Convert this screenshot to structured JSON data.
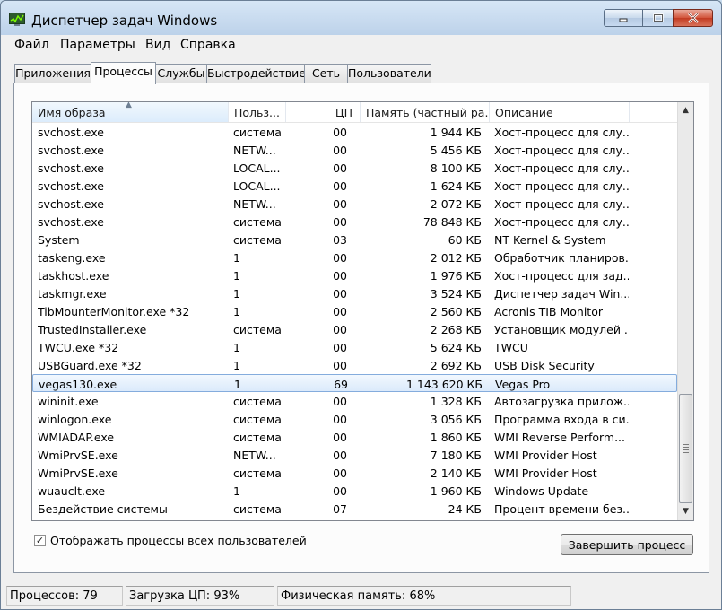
{
  "window": {
    "title": "Диспетчер задач Windows",
    "caption_buttons": {
      "minimize": "minimize-icon",
      "maximize": "maximize-icon",
      "close": "close-icon"
    }
  },
  "menu": [
    "Файл",
    "Параметры",
    "Вид",
    "Справка"
  ],
  "tabs": [
    {
      "label": "Приложения",
      "active": false
    },
    {
      "label": "Процессы",
      "active": true
    },
    {
      "label": "Службы",
      "active": false
    },
    {
      "label": "Быстродействие",
      "active": false
    },
    {
      "label": "Сеть",
      "active": false
    },
    {
      "label": "Пользователи",
      "active": false
    }
  ],
  "table": {
    "columns": [
      "Имя образа",
      "Польз...",
      "ЦП",
      "Память (частный ра...",
      "Описание"
    ],
    "sorted_column": "Имя образа",
    "rows": [
      {
        "name": "svchost.exe",
        "user": "система",
        "cpu": "00",
        "mem": "1 944 КБ",
        "desc": "Хост-процесс для слу..."
      },
      {
        "name": "svchost.exe",
        "user": "NETW...",
        "cpu": "00",
        "mem": "5 456 КБ",
        "desc": "Хост-процесс для слу..."
      },
      {
        "name": "svchost.exe",
        "user": "LOCAL...",
        "cpu": "00",
        "mem": "8 100 КБ",
        "desc": "Хост-процесс для слу..."
      },
      {
        "name": "svchost.exe",
        "user": "LOCAL...",
        "cpu": "00",
        "mem": "1 624 КБ",
        "desc": "Хост-процесс для слу..."
      },
      {
        "name": "svchost.exe",
        "user": "NETW...",
        "cpu": "00",
        "mem": "2 072 КБ",
        "desc": "Хост-процесс для слу..."
      },
      {
        "name": "svchost.exe",
        "user": "система",
        "cpu": "00",
        "mem": "78 848 КБ",
        "desc": "Хост-процесс для слу..."
      },
      {
        "name": "System",
        "user": "система",
        "cpu": "03",
        "mem": "60 КБ",
        "desc": "NT Kernel & System"
      },
      {
        "name": "taskeng.exe",
        "user": "1",
        "cpu": "00",
        "mem": "2 012 КБ",
        "desc": "Обработчик планиров..."
      },
      {
        "name": "taskhost.exe",
        "user": "1",
        "cpu": "00",
        "mem": "1 976 КБ",
        "desc": "Хост-процесс для зад..."
      },
      {
        "name": "taskmgr.exe",
        "user": "1",
        "cpu": "00",
        "mem": "3 524 КБ",
        "desc": "Диспетчер задач Win..."
      },
      {
        "name": "TibMounterMonitor.exe *32",
        "user": "1",
        "cpu": "00",
        "mem": "2 560 КБ",
        "desc": "Acronis TIB Monitor"
      },
      {
        "name": "TrustedInstaller.exe",
        "user": "система",
        "cpu": "00",
        "mem": "2 268 КБ",
        "desc": "Установщик модулей ..."
      },
      {
        "name": "TWCU.exe *32",
        "user": "1",
        "cpu": "00",
        "mem": "5 624 КБ",
        "desc": "TWCU"
      },
      {
        "name": "USBGuard.exe *32",
        "user": "1",
        "cpu": "00",
        "mem": "2 692 КБ",
        "desc": "USB Disk Security"
      },
      {
        "name": "vegas130.exe",
        "user": "1",
        "cpu": "69",
        "mem": "1 143 620 КБ",
        "desc": "Vegas Pro",
        "selected": true
      },
      {
        "name": "wininit.exe",
        "user": "система",
        "cpu": "00",
        "mem": "1 328 КБ",
        "desc": "Автозагрузка прилож..."
      },
      {
        "name": "winlogon.exe",
        "user": "система",
        "cpu": "00",
        "mem": "3 056 КБ",
        "desc": "Программа входа в си..."
      },
      {
        "name": "WMIADAP.exe",
        "user": "система",
        "cpu": "00",
        "mem": "1 860 КБ",
        "desc": "WMI Reverse Perform..."
      },
      {
        "name": "WmiPrvSE.exe",
        "user": "NETW...",
        "cpu": "00",
        "mem": "7 180 КБ",
        "desc": "WMI Provider Host"
      },
      {
        "name": "WmiPrvSE.exe",
        "user": "система",
        "cpu": "00",
        "mem": "2 140 КБ",
        "desc": "WMI Provider Host"
      },
      {
        "name": "wuauclt.exe",
        "user": "1",
        "cpu": "00",
        "mem": "1 960 КБ",
        "desc": "Windows Update"
      },
      {
        "name": "Бездействие системы",
        "user": "система",
        "cpu": "07",
        "mem": "24 КБ",
        "desc": "Процент времени без..."
      }
    ]
  },
  "show_all_users": {
    "label": "Отображать процессы всех пользователей",
    "checked": true
  },
  "end_process_button": "Завершить процесс",
  "status": {
    "processes": "Процессов: 79",
    "cpu": "Загрузка ЦП: 93%",
    "memory": "Физическая память: 68%"
  },
  "colors": {
    "selection": "#dbeafb",
    "selection_border": "#84acdd",
    "title_bg": "#c2d6ec",
    "close_button": "#c23b22"
  }
}
